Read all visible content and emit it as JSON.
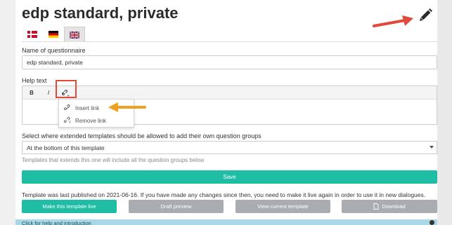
{
  "page": {
    "title": "edp standard, private"
  },
  "tabs": [
    {
      "icon": "danish-flag-icon"
    },
    {
      "icon": "german-flag-icon"
    },
    {
      "icon": "uk-flag-icon",
      "active": true
    }
  ],
  "form": {
    "name_label": "Name of questionnaire",
    "name_value": "edp standard, private",
    "help_label": "Help text",
    "toolbar": {
      "bold": "B",
      "italic": "I"
    },
    "link_menu": {
      "insert": "Insert link",
      "remove": "Remove link"
    },
    "extended_label": "Select where extended templates should be allowed to add their own question groups",
    "extended_value": "At the bottom of this template",
    "extended_hint": "Templates that extends this one will include all the question groups below",
    "save_label": "Save"
  },
  "publish": {
    "notice": "Template was last published on 2021-06-16. If you have made any changes since then, you need to make it live again in order to use it in new dialogues.",
    "make_live": "Make this template live",
    "draft_preview": "Draft preview",
    "view_current": "View current template",
    "download": "Download"
  },
  "help_bar": {
    "label": "Click for help and introduction"
  },
  "colors": {
    "primary": "#1fbea4",
    "grey_button": "#a9adb1",
    "annotation_red": "#e04a3a",
    "annotation_orange": "#f0a020",
    "help_bar": "#a8d8e6"
  }
}
